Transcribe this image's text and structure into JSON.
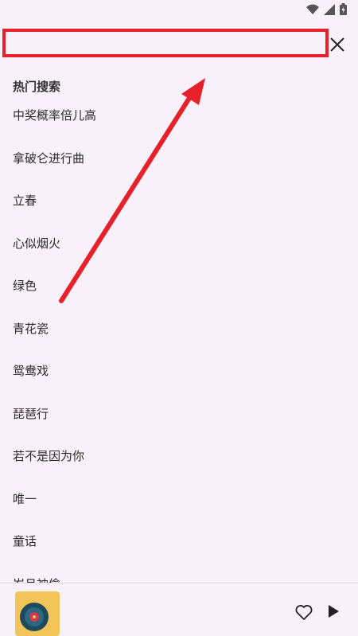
{
  "status_bar": {
    "icons": [
      "wifi-icon",
      "signal-icon",
      "battery-icon"
    ]
  },
  "search": {
    "placeholder": "",
    "value": ""
  },
  "hot_search": {
    "title": "热门搜索",
    "items": [
      "中奖概率倍儿高",
      "拿破仑进行曲",
      "立春",
      "心似烟火",
      "绿色",
      "青花瓷",
      "鸳鸯戏",
      "琵琶行",
      "若不是因为你",
      "唯一",
      "童话",
      "岁月神偷"
    ]
  },
  "player": {
    "icons": [
      "album-art",
      "heart-icon",
      "play-icon"
    ]
  },
  "colors": {
    "annotation": "#e8202a",
    "background": "#f9f1f9",
    "album": "#f3c558"
  }
}
